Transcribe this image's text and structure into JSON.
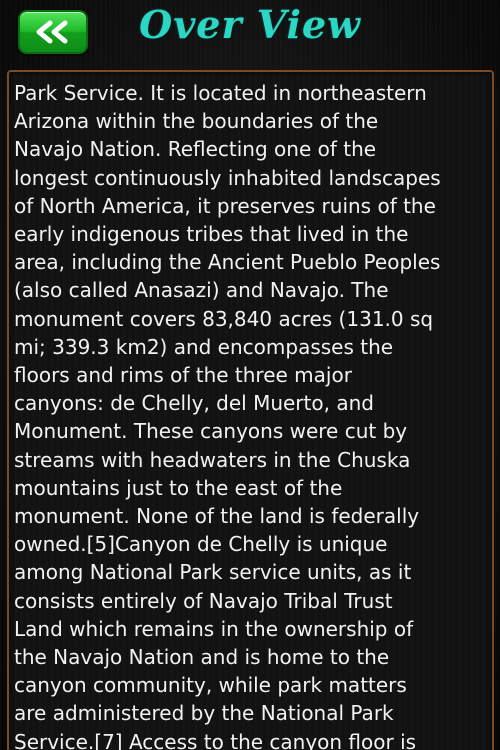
{
  "header": {
    "back_icon": "double-chevron-left-icon",
    "title": "Over View"
  },
  "colors": {
    "title": "#2bd7c4",
    "back_button": "#20b92a",
    "panel_border": "#7b4b25",
    "text": "#f2f2f2"
  },
  "overview": {
    "text": "Park Service. It is located in northeastern\nArizona within the boundaries of the\nNavajo Nation. Reflecting one of the\nlongest continuously inhabited landscapes\nof North America, it preserves ruins of the\nearly indigenous tribes that lived in the\narea, including the Ancient Pueblo Peoples\n(also called Anasazi) and Navajo. The\nmonument covers 83,840 acres (131.0 sq\nmi; 339.3 km2) and encompasses the\nfloors and rims of the three major\ncanyons: de Chelly, del Muerto, and\nMonument. These canyons were cut by\nstreams with headwaters in the Chuska\nmountains just to the east of the\nmonument. None of the land is federally\nowned.[5]Canyon de Chelly is unique\namong National Park service units, as it\nconsists entirely of Navajo Tribal Trust\nLand which remains in the ownership of\nthe Navajo Nation and is home to the\ncanyon community, while park matters\nare administered by the National Park\nService.[7] Access to the canyon floor is"
  }
}
